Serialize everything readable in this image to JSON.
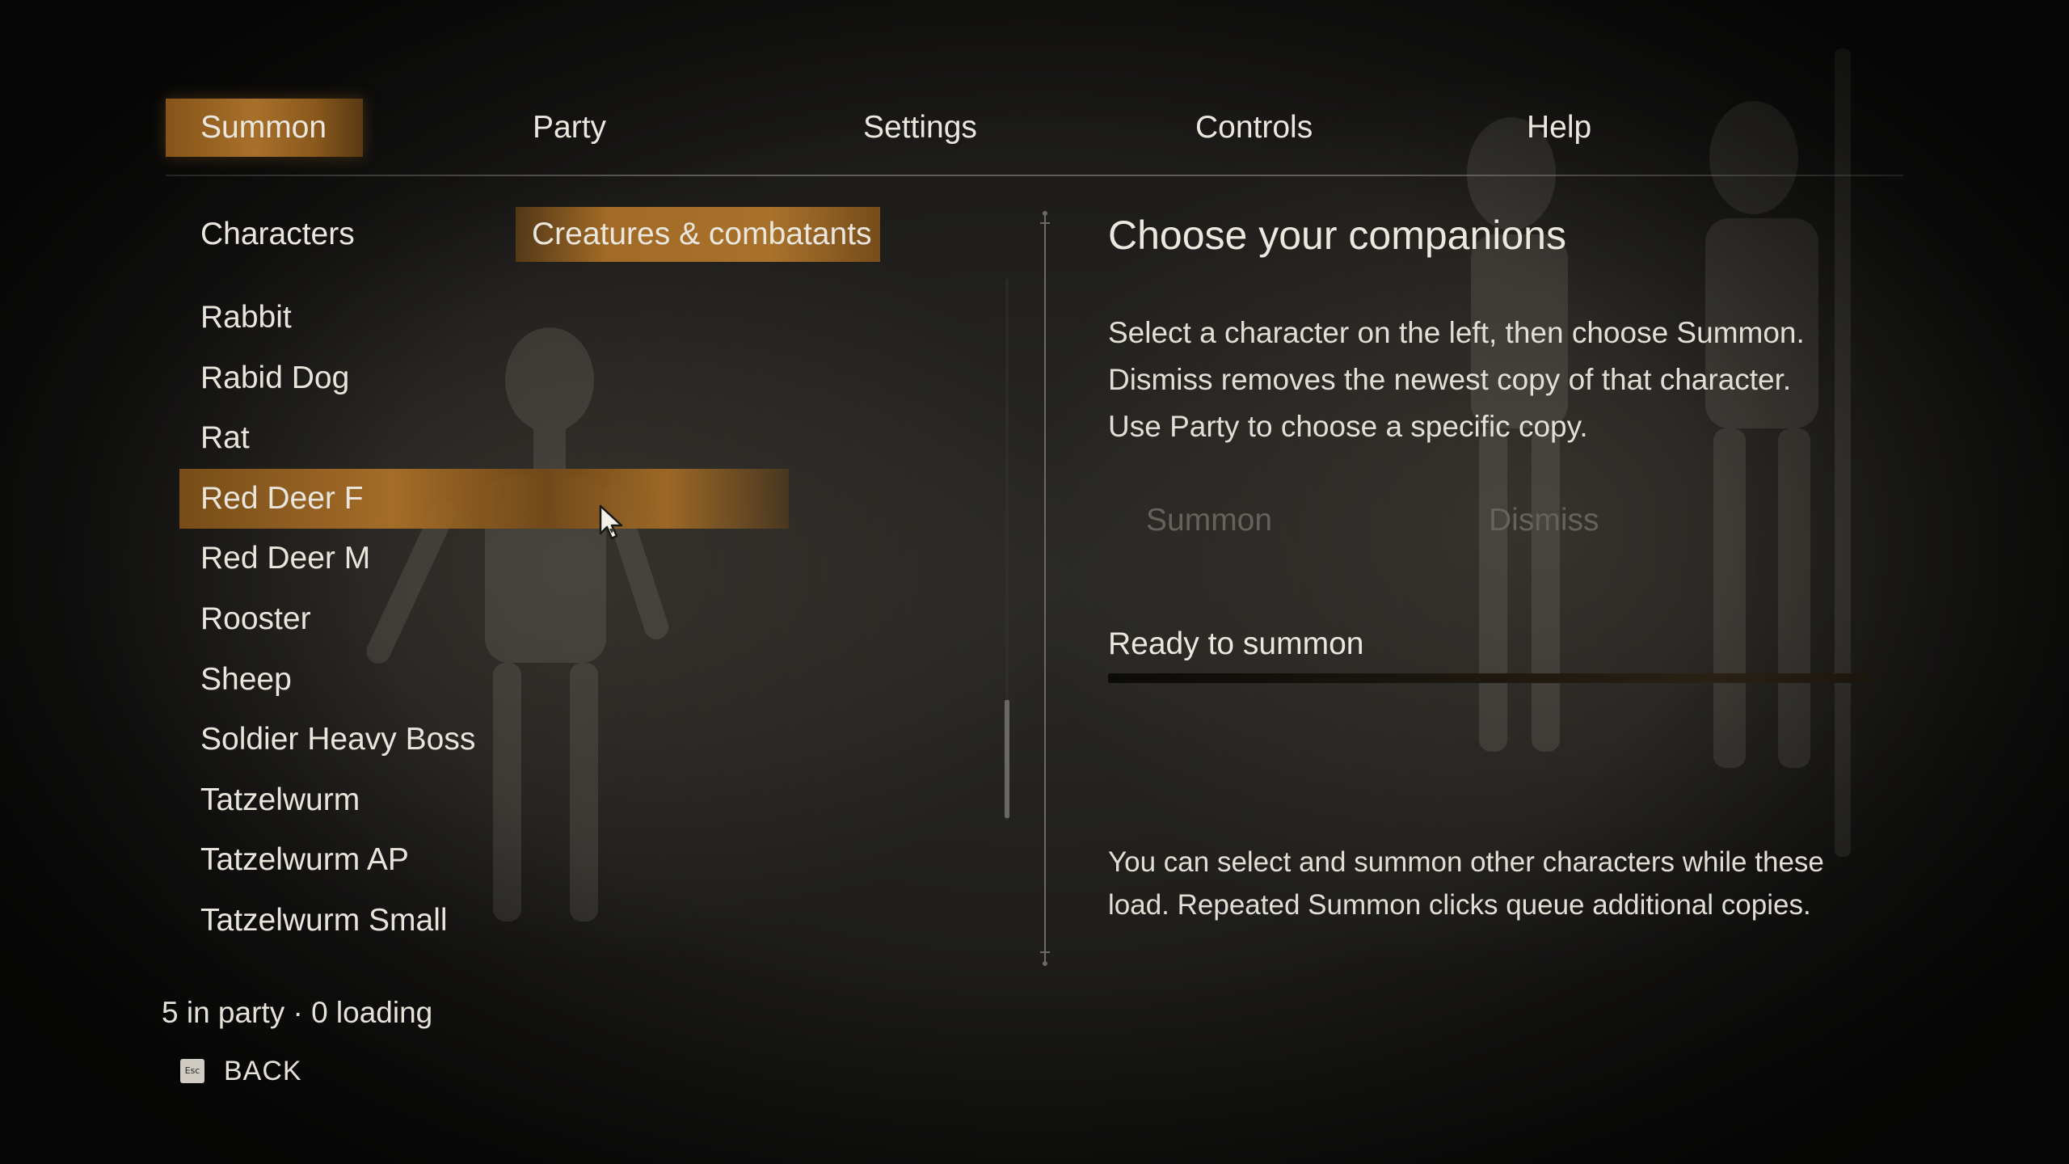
{
  "nav": {
    "tabs": [
      {
        "label": "Summon",
        "active": true
      },
      {
        "label": "Party",
        "active": false
      },
      {
        "label": "Settings",
        "active": false
      },
      {
        "label": "Controls",
        "active": false
      },
      {
        "label": "Help",
        "active": false
      }
    ]
  },
  "filters": {
    "tabs": [
      {
        "label": "Characters",
        "active": false
      },
      {
        "label": "Creatures & combatants",
        "active": true
      }
    ]
  },
  "characters": {
    "items": [
      {
        "label": "Rabbit",
        "selected": false
      },
      {
        "label": "Rabid Dog",
        "selected": false
      },
      {
        "label": "Rat",
        "selected": false
      },
      {
        "label": "Red Deer F",
        "selected": true
      },
      {
        "label": "Red Deer M",
        "selected": false
      },
      {
        "label": "Rooster",
        "selected": false
      },
      {
        "label": "Sheep",
        "selected": false
      },
      {
        "label": "Soldier Heavy Boss",
        "selected": false
      },
      {
        "label": "Tatzelwurm",
        "selected": false
      },
      {
        "label": "Tatzelwurm AP",
        "selected": false
      },
      {
        "label": "Tatzelwurm Small",
        "selected": false
      }
    ]
  },
  "panel": {
    "title": "Choose your companions",
    "description": [
      "Select a character on the left, then choose Summon.",
      "Dismiss removes the newest copy of that character.",
      "Use Party to choose a specific copy."
    ],
    "summon_label": "Summon",
    "dismiss_label": "Dismiss",
    "status": "Ready to summon",
    "progress": 0,
    "note": [
      "You can select and summon other characters while these",
      "load. Repeated Summon clicks queue additional copies."
    ]
  },
  "footer": {
    "party_status": "5 in party · 0 loading",
    "back_key": "Esc",
    "back_label": "BACK"
  },
  "colors": {
    "accent": "#b07a30",
    "text": "#ebe7df",
    "disabled": "#65625c",
    "background": "#1c1b19"
  },
  "icons": {
    "back_key": "esc-key-icon",
    "cursor": "mouse-cursor-icon"
  }
}
